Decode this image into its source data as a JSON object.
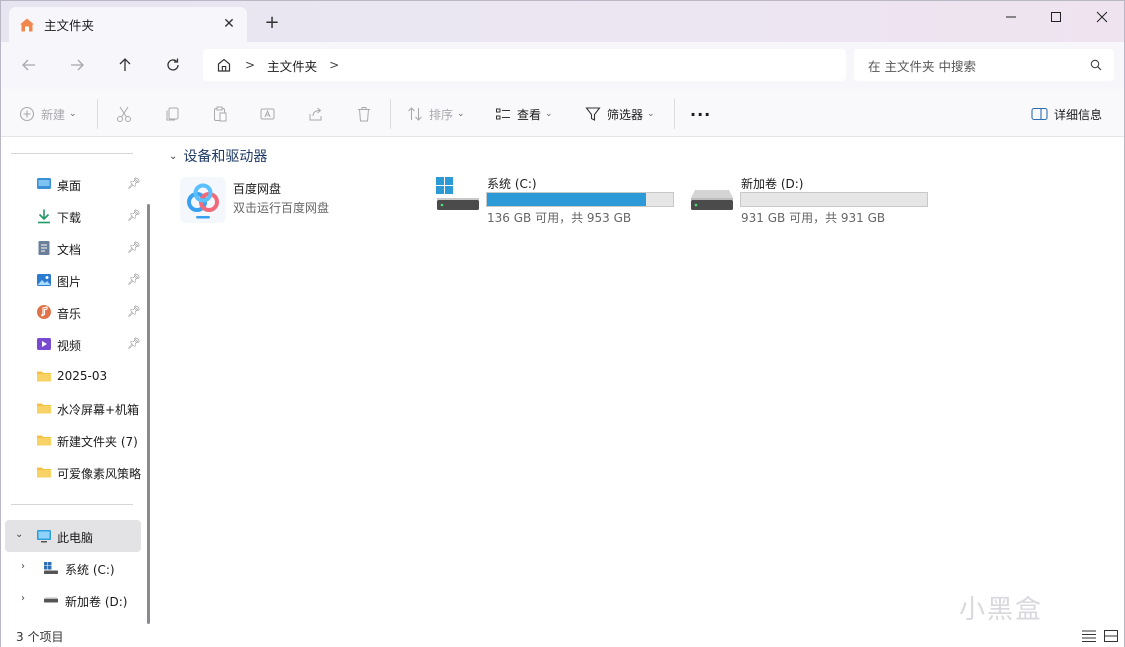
{
  "window": {
    "tab_title": "主文件夹",
    "new_tab": "+",
    "close_tab": "✕"
  },
  "nav": {
    "breadcrumb": [
      "主文件夹"
    ],
    "search_placeholder": "在 主文件夹 中搜索"
  },
  "toolbar": {
    "new_label": "新建",
    "sort_label": "排序",
    "view_label": "查看",
    "filter_label": "筛选器",
    "more_label": "···",
    "details_label": "详细信息"
  },
  "sidebar": {
    "quick_access": [
      {
        "label": "桌面",
        "icon": "desktop-icon",
        "pinned": true
      },
      {
        "label": "下载",
        "icon": "download-icon",
        "pinned": true
      },
      {
        "label": "文档",
        "icon": "document-icon",
        "pinned": true
      },
      {
        "label": "图片",
        "icon": "pictures-icon",
        "pinned": true
      },
      {
        "label": "音乐",
        "icon": "music-icon",
        "pinned": true
      },
      {
        "label": "视频",
        "icon": "video-icon",
        "pinned": true
      },
      {
        "label": "2025-03",
        "icon": "folder-icon",
        "pinned": false
      },
      {
        "label": "水冷屏幕+机箱",
        "icon": "folder-icon",
        "pinned": false
      },
      {
        "label": "新建文件夹 (7)",
        "icon": "folder-icon",
        "pinned": false
      },
      {
        "label": "可爱像素风策略",
        "icon": "folder-icon",
        "pinned": false
      }
    ],
    "this_pc": "此电脑",
    "drives": [
      {
        "label": "系统 (C:)",
        "icon": "windows-drive-icon"
      },
      {
        "label": "新加卷 (D:)",
        "icon": "drive-icon"
      }
    ]
  },
  "main": {
    "group_title": "设备和驱动器",
    "items": [
      {
        "name": "百度网盘",
        "sub": "双击运行百度网盘",
        "icon": "baidu-netdisk-icon"
      },
      {
        "name": "系统 (C:)",
        "sub": "136 GB 可用，共 953 GB",
        "used_fraction": 0.857,
        "icon": "windows-drive-icon"
      },
      {
        "name": "新加卷 (D:)",
        "sub": "931 GB 可用，共 931 GB",
        "used_fraction": 0.0,
        "icon": "drive-icon"
      }
    ]
  },
  "status": {
    "count": "3 个项目"
  },
  "watermark": "小黑盒",
  "colors": {
    "accent": "#2d9ad8",
    "folder": "#f4c048",
    "selected": "#e3e3e6"
  }
}
